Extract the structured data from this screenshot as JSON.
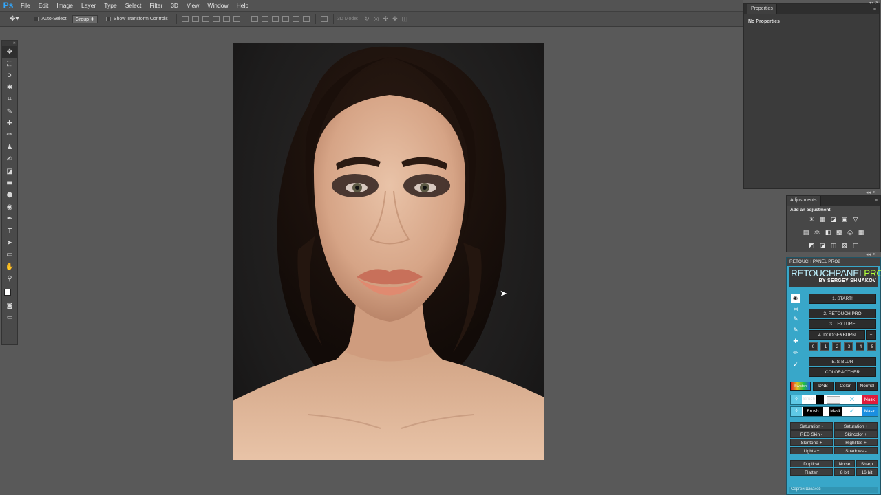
{
  "app": {
    "logo": "Ps"
  },
  "menu": [
    "File",
    "Edit",
    "Image",
    "Layer",
    "Type",
    "Select",
    "Filter",
    "3D",
    "View",
    "Window",
    "Help"
  ],
  "options_bar": {
    "auto_select_label": "Auto-Select:",
    "auto_select_value": "Group",
    "show_transform_label": "Show Transform Controls",
    "mode_3d_label": "3D Mode:"
  },
  "tools": [
    "move-tool",
    "marquee-tool",
    "lasso-tool",
    "quick-select-tool",
    "crop-tool",
    "eyedropper-tool",
    "healing-brush-tool",
    "brush-tool",
    "clone-stamp-tool",
    "history-brush-tool",
    "eraser-tool",
    "gradient-tool",
    "blur-tool",
    "dodge-tool",
    "pen-tool",
    "type-tool",
    "path-select-tool",
    "rectangle-tool",
    "hand-tool",
    "zoom-tool"
  ],
  "tool_glyphs": [
    "✥",
    "⬚",
    "ↄ",
    "✱",
    "⌗",
    "✎",
    "✚",
    "✏",
    "♟",
    "✍",
    "◪",
    "▬",
    "●",
    "◉",
    "✒",
    "T",
    "➤",
    "▭",
    "✋",
    "⚲"
  ],
  "properties_panel": {
    "tab": "Properties",
    "message": "No Properties"
  },
  "adjustments_panel": {
    "tab": "Adjustments",
    "heading": "Add an adjustment",
    "row1": [
      "☀",
      "▦",
      "◪",
      "▣",
      "▽"
    ],
    "row2": [
      "▤",
      "⚖",
      "◧",
      "▩",
      "◎",
      "▦"
    ],
    "row3": [
      "◩",
      "◪",
      "◫",
      "⊠",
      "▢"
    ]
  },
  "retouch_panel": {
    "tab": "RETOUCH PANEL PRO2",
    "logo_main": "RETOUCHPANEL",
    "logo_pro": "PRO",
    "logo_by": "BY SERGEY SHMAKOV",
    "buttons": {
      "start": "1. START!",
      "retouch_pro": "2. RETOUCH PRO",
      "texture": "3. TEXTURE",
      "dodge_burn": "4. DODGE&BURN",
      "dodge_plus": "+",
      "s_blur": "5. S-BLUR",
      "color_other": "COLOR&OTHER"
    },
    "dodge_levels": [
      "0",
      "-1",
      "-2",
      "-3",
      "-4",
      "-5"
    ],
    "mode_buttons": [
      "Swatch",
      "DNB",
      "Color",
      "Normal"
    ],
    "brush_row1": [
      "Brush",
      "Mask"
    ],
    "brush_row2": [
      "Brush",
      "Mask",
      "Mask"
    ],
    "adjust_left": [
      "Saturation -",
      "RED Skin -",
      "Skintone +",
      "Lights +"
    ],
    "adjust_right": [
      "Saturation +",
      "Skincolor +",
      "Highlites +",
      "Shadows -"
    ],
    "bottom": {
      "duplicat": "Duplicat",
      "flatten": "Flatten",
      "noise": "Noise",
      "bit8": "8 bit",
      "sharp": "Sharp",
      "bit16": "16 bit"
    },
    "footer": "Сергей Шмаков"
  },
  "colors": {
    "panel_accent": "#38a7c9",
    "ps_blue": "#31a8ff",
    "pro_green": "#b3ff3b"
  }
}
